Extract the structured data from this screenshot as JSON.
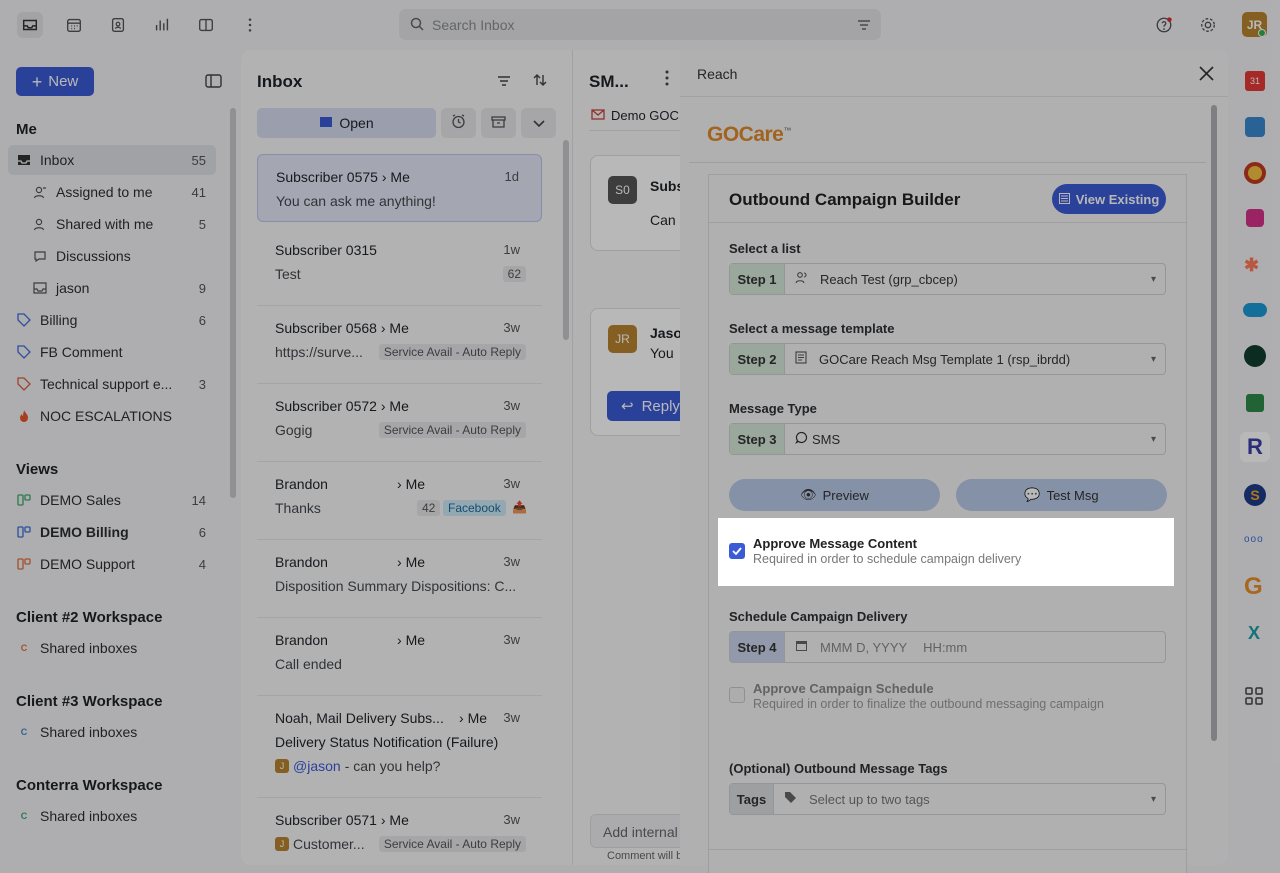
{
  "search": {
    "placeholder": "Search Inbox"
  },
  "user": {
    "initials": "JR"
  },
  "sidebar": {
    "new_label": "New",
    "me_title": "Me",
    "items": [
      {
        "label": "Inbox",
        "count": "55"
      },
      {
        "label": "Assigned to me",
        "count": "41"
      },
      {
        "label": "Shared with me",
        "count": "5"
      },
      {
        "label": "Discussions",
        "count": ""
      },
      {
        "label": "jason",
        "count": "9"
      },
      {
        "label": "Billing",
        "count": "6"
      },
      {
        "label": "FB Comment",
        "count": ""
      },
      {
        "label": "Technical support e...",
        "count": "3"
      },
      {
        "label": "NOC ESCALATIONS",
        "count": ""
      }
    ],
    "views_title": "Views",
    "views": [
      {
        "label": "DEMO Sales",
        "count": "14"
      },
      {
        "label": "DEMO Billing",
        "count": "6"
      },
      {
        "label": "DEMO Support",
        "count": "4"
      }
    ],
    "workspaces": [
      {
        "title": "Client #2 Workspace",
        "item": "Shared inboxes",
        "letter": "C",
        "color": "#e0703a"
      },
      {
        "title": "Client #3 Workspace",
        "item": "Shared inboxes",
        "letter": "C",
        "color": "#3a8ad0"
      },
      {
        "title": "Conterra Workspace",
        "item": "Shared inboxes",
        "letter": "C",
        "color": "#3aa86a"
      }
    ]
  },
  "inbox": {
    "title": "Inbox",
    "open_label": "Open",
    "items": [
      {
        "name": "Subscriber 0575",
        "to": "Me",
        "time": "1d",
        "preview": "You can ask me anything!",
        "tag": ""
      },
      {
        "name": "Subscriber 0315",
        "to": "",
        "time": "1w",
        "preview": "Test",
        "tag": "62"
      },
      {
        "name": "Subscriber 0568",
        "to": "Me",
        "time": "3w",
        "preview": "https://surve...",
        "tag": "Service Avail - Auto Reply"
      },
      {
        "name": "Subscriber 0572",
        "to": "Me",
        "time": "3w",
        "preview": "Gogig",
        "tag": "Service Avail - Auto Reply"
      },
      {
        "name": "Brandon",
        "to": "Me",
        "time": "3w",
        "preview": "Thanks",
        "tag": "42",
        "tag2": "Facebook"
      },
      {
        "name": "Brandon",
        "to": "Me",
        "time": "3w",
        "preview": "Disposition Summary Dispositions: C...",
        "tag": ""
      },
      {
        "name": "Brandon",
        "to": "Me",
        "time": "3w",
        "preview": "Call ended",
        "tag": ""
      },
      {
        "name": "Noah, Mail Delivery Subs...",
        "to": "Me",
        "time": "3w",
        "preview": "Delivery Status Notification (Failure)",
        "preview2": "@jason",
        "preview3": " - can you help?",
        "tag": ""
      },
      {
        "name": "Subscriber 0571",
        "to": "Me",
        "time": "3w",
        "preview": "Customer...",
        "tag": "Service Avail - Auto Reply"
      }
    ]
  },
  "conversation": {
    "title": "SM...",
    "inbox_tag": "Demo GOC",
    "msg1_avatar": "S0",
    "msg1_name": "Subs",
    "msg1_text": "Can",
    "msg2_avatar": "JR",
    "msg2_name": "Jaso",
    "msg2_text": "You",
    "reply_label": "Reply",
    "comment_placeholder": "Add internal",
    "comment_hint": "Comment will b"
  },
  "reach": {
    "title": "Reach",
    "logo": "GOCare",
    "logo_tm": "™",
    "builder_title": "Outbound Campaign Builder",
    "view_existing": "View Existing",
    "list_label": "Select a list",
    "step1": "Step 1",
    "list_value": "Reach Test (grp_cbcep)",
    "template_label": "Select a message template",
    "step2": "Step 2",
    "template_value": "GOCare Reach Msg Template 1 (rsp_ibrdd)",
    "type_label": "Message Type",
    "step3": "Step 3",
    "type_value": "SMS",
    "preview_label": "Preview",
    "test_label": "Test Msg",
    "approve_title": "Approve Message Content",
    "approve_sub": "Required in order to schedule campaign delivery",
    "schedule_label": "Schedule Campaign Delivery",
    "step4": "Step 4",
    "date_placeholder": "MMM D, YYYY",
    "time_placeholder": "HH:mm",
    "approve_sched_title": "Approve Campaign Schedule",
    "approve_sched_sub": "Required in order to finalize the outbound messaging campaign",
    "tags_label": "(Optional) Outbound Message Tags",
    "tags_step": "Tags",
    "tags_placeholder": "Select up to two tags"
  }
}
